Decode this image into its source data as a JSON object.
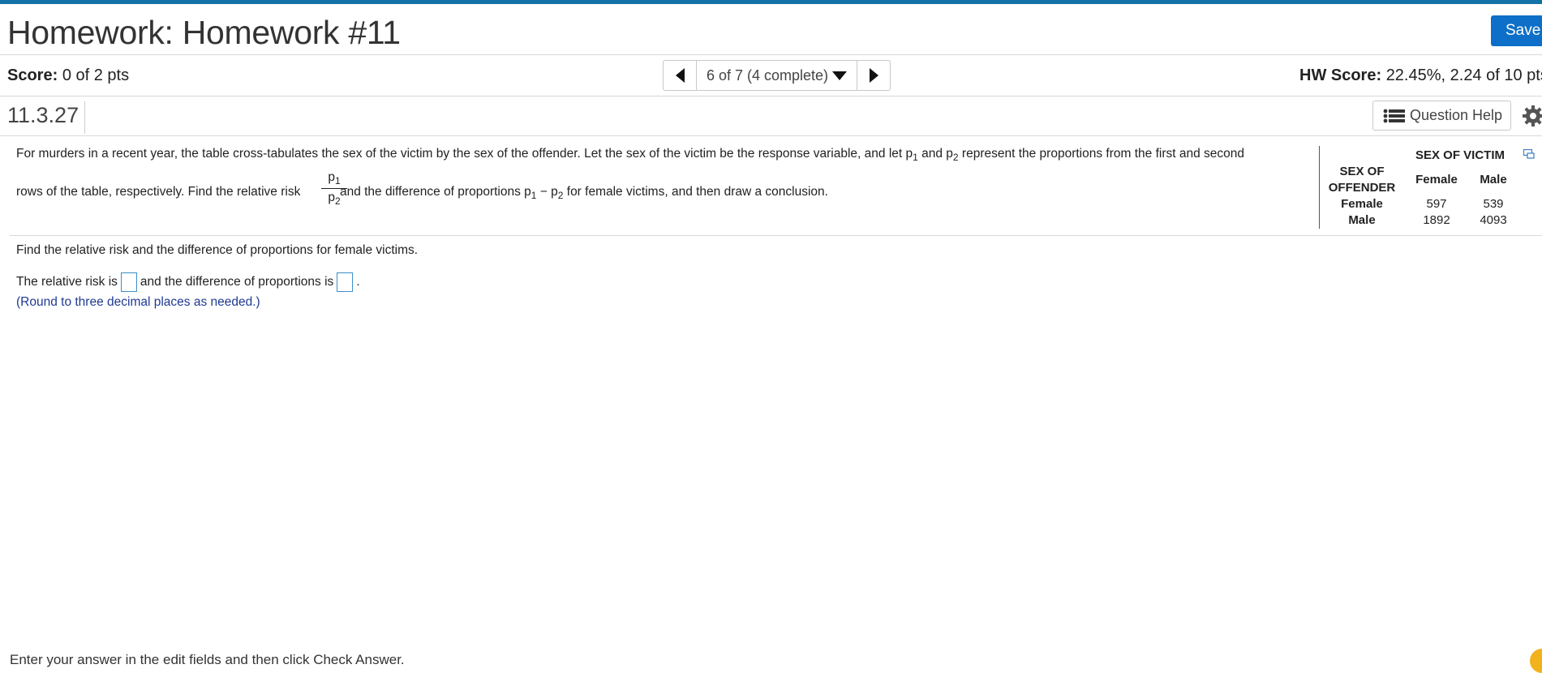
{
  "header": {
    "title": "Homework: Homework #11",
    "save_label": "Save"
  },
  "score_bar": {
    "score_label": "Score:",
    "score_value": "0 of 2 pts",
    "nav_label": "6 of 7 (4 complete)",
    "hw_score_label": "HW Score:",
    "hw_score_value": "22.45%, 2.24 of 10 pts"
  },
  "question": {
    "id": "11.3.27",
    "help_label": "Question Help"
  },
  "problem": {
    "line1_a": "For murders in a recent year, the table cross-tabulates the sex of the victim by the sex of the offender.  Let the sex of the victim be the response variable, and let p",
    "line1_b": " and p",
    "line1_c": " represent the proportions from the first and second",
    "line2_a": "rows of the table, respectively.  Find the relative risk ",
    "line2_b": " and the difference of proportions p",
    "line2_c": " − p",
    "line2_d": " for female victims, and then draw a conclusion.",
    "p_letter": "p",
    "sub1": "1",
    "sub2": "2"
  },
  "table": {
    "victim_header": "SEX OF VICTIM",
    "offender_header_1": "SEX OF",
    "offender_header_2": "OFFENDER",
    "columns": [
      "Female",
      "Male"
    ],
    "rows": [
      {
        "label": "Female",
        "values": [
          "597",
          "539"
        ]
      },
      {
        "label": "Male",
        "values": [
          "1892",
          "4093"
        ]
      }
    ]
  },
  "part": {
    "instruction": "Find the relative risk and the difference of proportions for female victims.",
    "answer_prefix": "The relative risk is",
    "answer_middle": "and the difference of proportions is",
    "answer_suffix": ".",
    "round_note": "(Round to three decimal places as needed.)"
  },
  "footer": {
    "text": "Enter your answer in the edit fields and then click Check Answer."
  },
  "colors": {
    "accent": "#1572a8",
    "save_button": "#0d6fc7",
    "note_text": "#1f3a93",
    "input_border": "#3a8fc8"
  }
}
